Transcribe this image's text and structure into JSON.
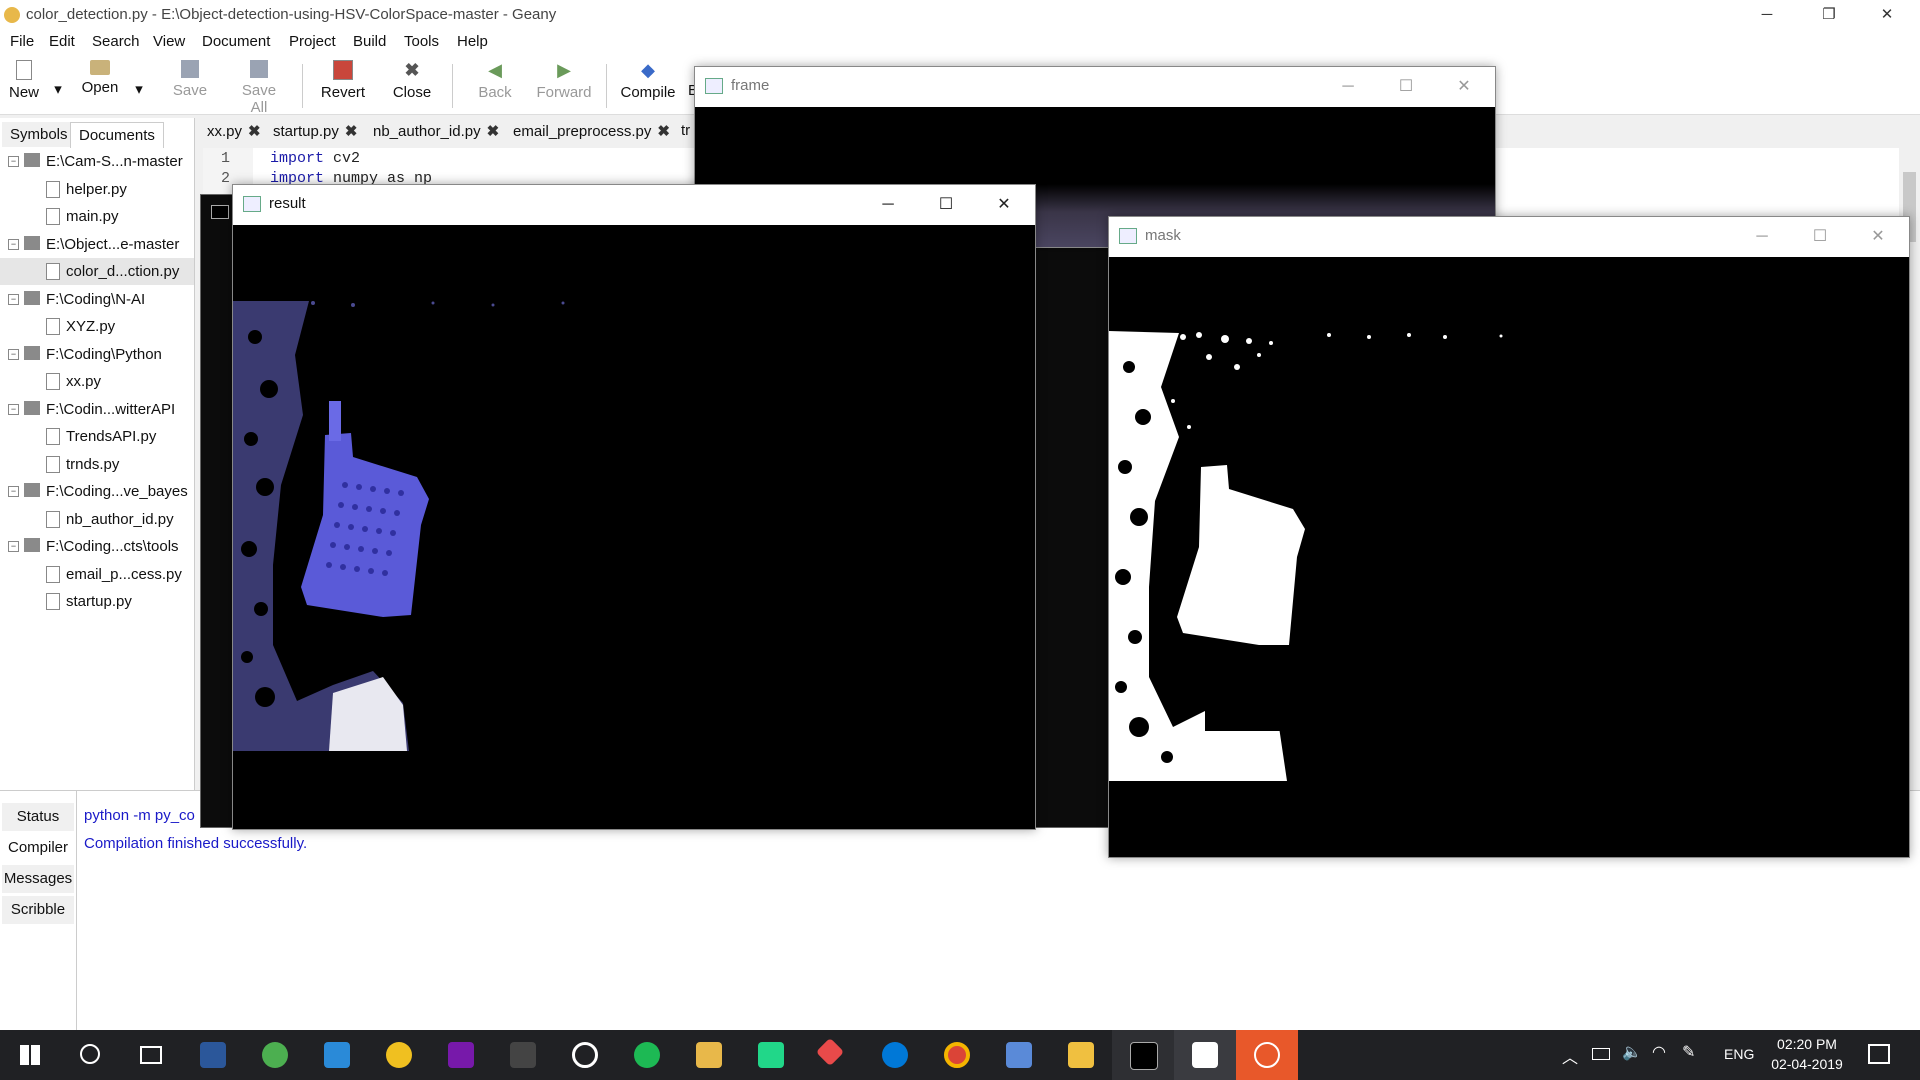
{
  "window": {
    "title": "color_detection.py - E:\\Object-detection-using-HSV-ColorSpace-master - Geany",
    "minimize": "─",
    "maximize": "❐",
    "close": "✕"
  },
  "menu": [
    "File",
    "Edit",
    "Search",
    "View",
    "Document",
    "Project",
    "Build",
    "Tools",
    "Help"
  ],
  "toolbar": {
    "new": "New",
    "open": "Open",
    "save": "Save",
    "save_all": "Save All",
    "revert": "Revert",
    "close": "Close",
    "back": "Back",
    "forward": "Forward",
    "compile": "Compile",
    "b_partial": "B"
  },
  "sidebar": {
    "tabs": [
      "Symbols",
      "Documents"
    ],
    "tree": [
      {
        "type": "folder",
        "label": "E:\\Cam-S...n-master"
      },
      {
        "type": "file",
        "label": "helper.py"
      },
      {
        "type": "file",
        "label": "main.py"
      },
      {
        "type": "folder",
        "label": "E:\\Object...e-master"
      },
      {
        "type": "file",
        "label": "color_d...ction.py",
        "selected": true
      },
      {
        "type": "folder",
        "label": "F:\\Coding\\N-AI"
      },
      {
        "type": "file",
        "label": "XYZ.py"
      },
      {
        "type": "folder",
        "label": "F:\\Coding\\Python"
      },
      {
        "type": "file",
        "label": "xx.py"
      },
      {
        "type": "folder",
        "label": "F:\\Codin...witterAPI"
      },
      {
        "type": "file",
        "label": "TrendsAPI.py"
      },
      {
        "type": "file",
        "label": "trnds.py"
      },
      {
        "type": "folder",
        "label": "F:\\Coding...ve_bayes"
      },
      {
        "type": "file",
        "label": "nb_author_id.py"
      },
      {
        "type": "folder",
        "label": "F:\\Coding...cts\\tools"
      },
      {
        "type": "file",
        "label": "email_p...cess.py"
      },
      {
        "type": "file",
        "label": "startup.py"
      }
    ]
  },
  "editor_tabs": [
    "xx.py",
    "startup.py",
    "nb_author_id.py",
    "email_preprocess.py",
    "tr"
  ],
  "editor": {
    "lines": [
      {
        "n": "1",
        "kw": "import",
        "rest": " cv2"
      },
      {
        "n": "2",
        "kw": "import",
        "rest": " numpy as np"
      }
    ]
  },
  "bottom": {
    "tabs": [
      "Status",
      "Compiler",
      "Messages",
      "Scribble"
    ],
    "command": "python -m py_co",
    "message": "Compilation finished successfully."
  },
  "windows": {
    "frame": {
      "title": "frame"
    },
    "result": {
      "title": "result"
    },
    "mask": {
      "title": "mask"
    }
  },
  "taskbar": {
    "lang": "ENG",
    "time": "02:20 PM",
    "date": "02-04-2019"
  },
  "colors": {
    "link_blue": "#1a1ac8",
    "accent_orange": "#e8582a",
    "result_blue": "#6a6ae0"
  }
}
